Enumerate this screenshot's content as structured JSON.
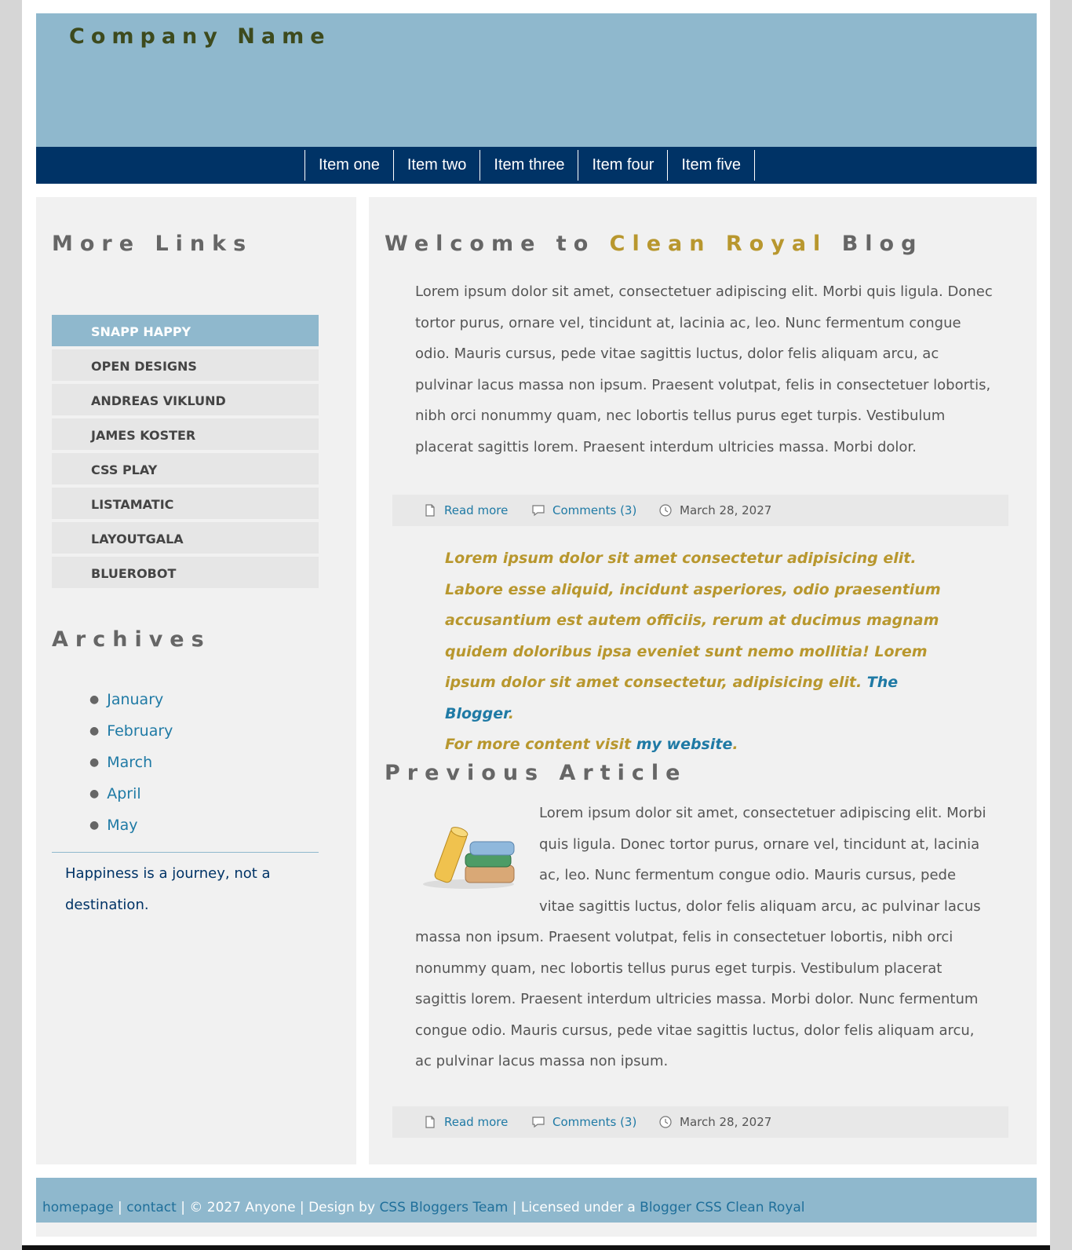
{
  "header": {
    "company_name": "Company Name"
  },
  "nav": {
    "items": [
      "Item one",
      "Item two",
      "Item three",
      "Item four",
      "Item five"
    ]
  },
  "sidebar": {
    "links_heading": "More Links",
    "links": [
      "SNAPP HAPPY",
      "OPEN DESIGNS",
      "ANDREAS VIKLUND",
      "JAMES KOSTER",
      "CSS PLAY",
      "LISTAMATIC",
      "LAYOUTGALA",
      "BLUEROBOT"
    ],
    "active_link": "SNAPP HAPPY",
    "archives_heading": "Archives",
    "archives": [
      "January",
      "February",
      "March",
      "April",
      "May"
    ],
    "quote": "Happiness is a journey, not a destination."
  },
  "main": {
    "welcome": {
      "prefix": "Welcome to ",
      "highlight": "Clean Royal",
      "suffix": " Blog"
    },
    "article1": "Lorem ipsum dolor sit amet, consectetuer adipiscing elit. Morbi quis ligula. Donec tortor purus, ornare vel, tincidunt at, lacinia ac, leo. Nunc fermentum congue odio. Mauris cursus, pede vitae sagittis luctus, dolor felis aliquam arcu, ac pulvinar lacus massa non ipsum. Praesent volutpat, felis in consectetuer lobortis, nibh orci nonummy quam, nec lobortis tellus purus eget turpis. Vestibulum placerat sagittis lorem. Praesent interdum ultricies massa. Morbi dolor.",
    "meta": {
      "read_more": "Read more",
      "comments": "Comments (3)",
      "date": "March 28, 2027"
    },
    "blockquote": {
      "text": "Lorem ipsum dolor sit amet consectetur adipisicing elit. Labore esse aliquid, incidunt asperiores, odio praesentium accusantium est autem officiis, rerum at ducimus magnam quidem doloribus ipsa eveniet sunt nemo mollitia! Lorem ipsum dolor sit amet consectetur, adipisicing elit. ",
      "author": "The Blogger",
      "period": ".",
      "visit_prefix": "For more content visit ",
      "visit_link": "my website",
      "visit_suffix": "."
    },
    "previous_heading": "Previous Article",
    "article2": "Lorem ipsum dolor sit amet, consectetuer adipiscing elit. Morbi quis ligula. Donec tortor purus, ornare vel, tincidunt at, lacinia ac, leo. Nunc fermentum congue odio. Mauris cursus, pede vitae sagittis luctus, dolor felis aliquam arcu, ac pulvinar lacus massa non ipsum. Praesent volutpat, felis in consectetuer lobortis, nibh orci nonummy quam, nec lobortis tellus purus eget turpis. Vestibulum placerat sagittis lorem. Praesent interdum ultricies massa. Morbi dolor. Nunc fermentum congue odio. Mauris cursus, pede vitae sagittis luctus, dolor felis aliquam arcu, ac pulvinar lacus massa non ipsum."
  },
  "footer": {
    "homepage": "homepage",
    "sep": " | ",
    "contact": "contact",
    "copyright": " | © 2027 Anyone | Design by ",
    "design_link": "CSS Bloggers Team",
    "license": " | Licensed under a ",
    "license_link": "Blogger CSS Clean Royal"
  },
  "colors": {
    "header_bg": "#8fb8cd",
    "nav_bg": "#003366",
    "accent_gold": "#b8972e",
    "link_blue": "#1f7aa5",
    "panel_bg": "#f1f1f1",
    "company_text": "#3d4a1d"
  },
  "icons": [
    "document-icon",
    "comment-icon",
    "clock-icon",
    "books-image"
  ]
}
